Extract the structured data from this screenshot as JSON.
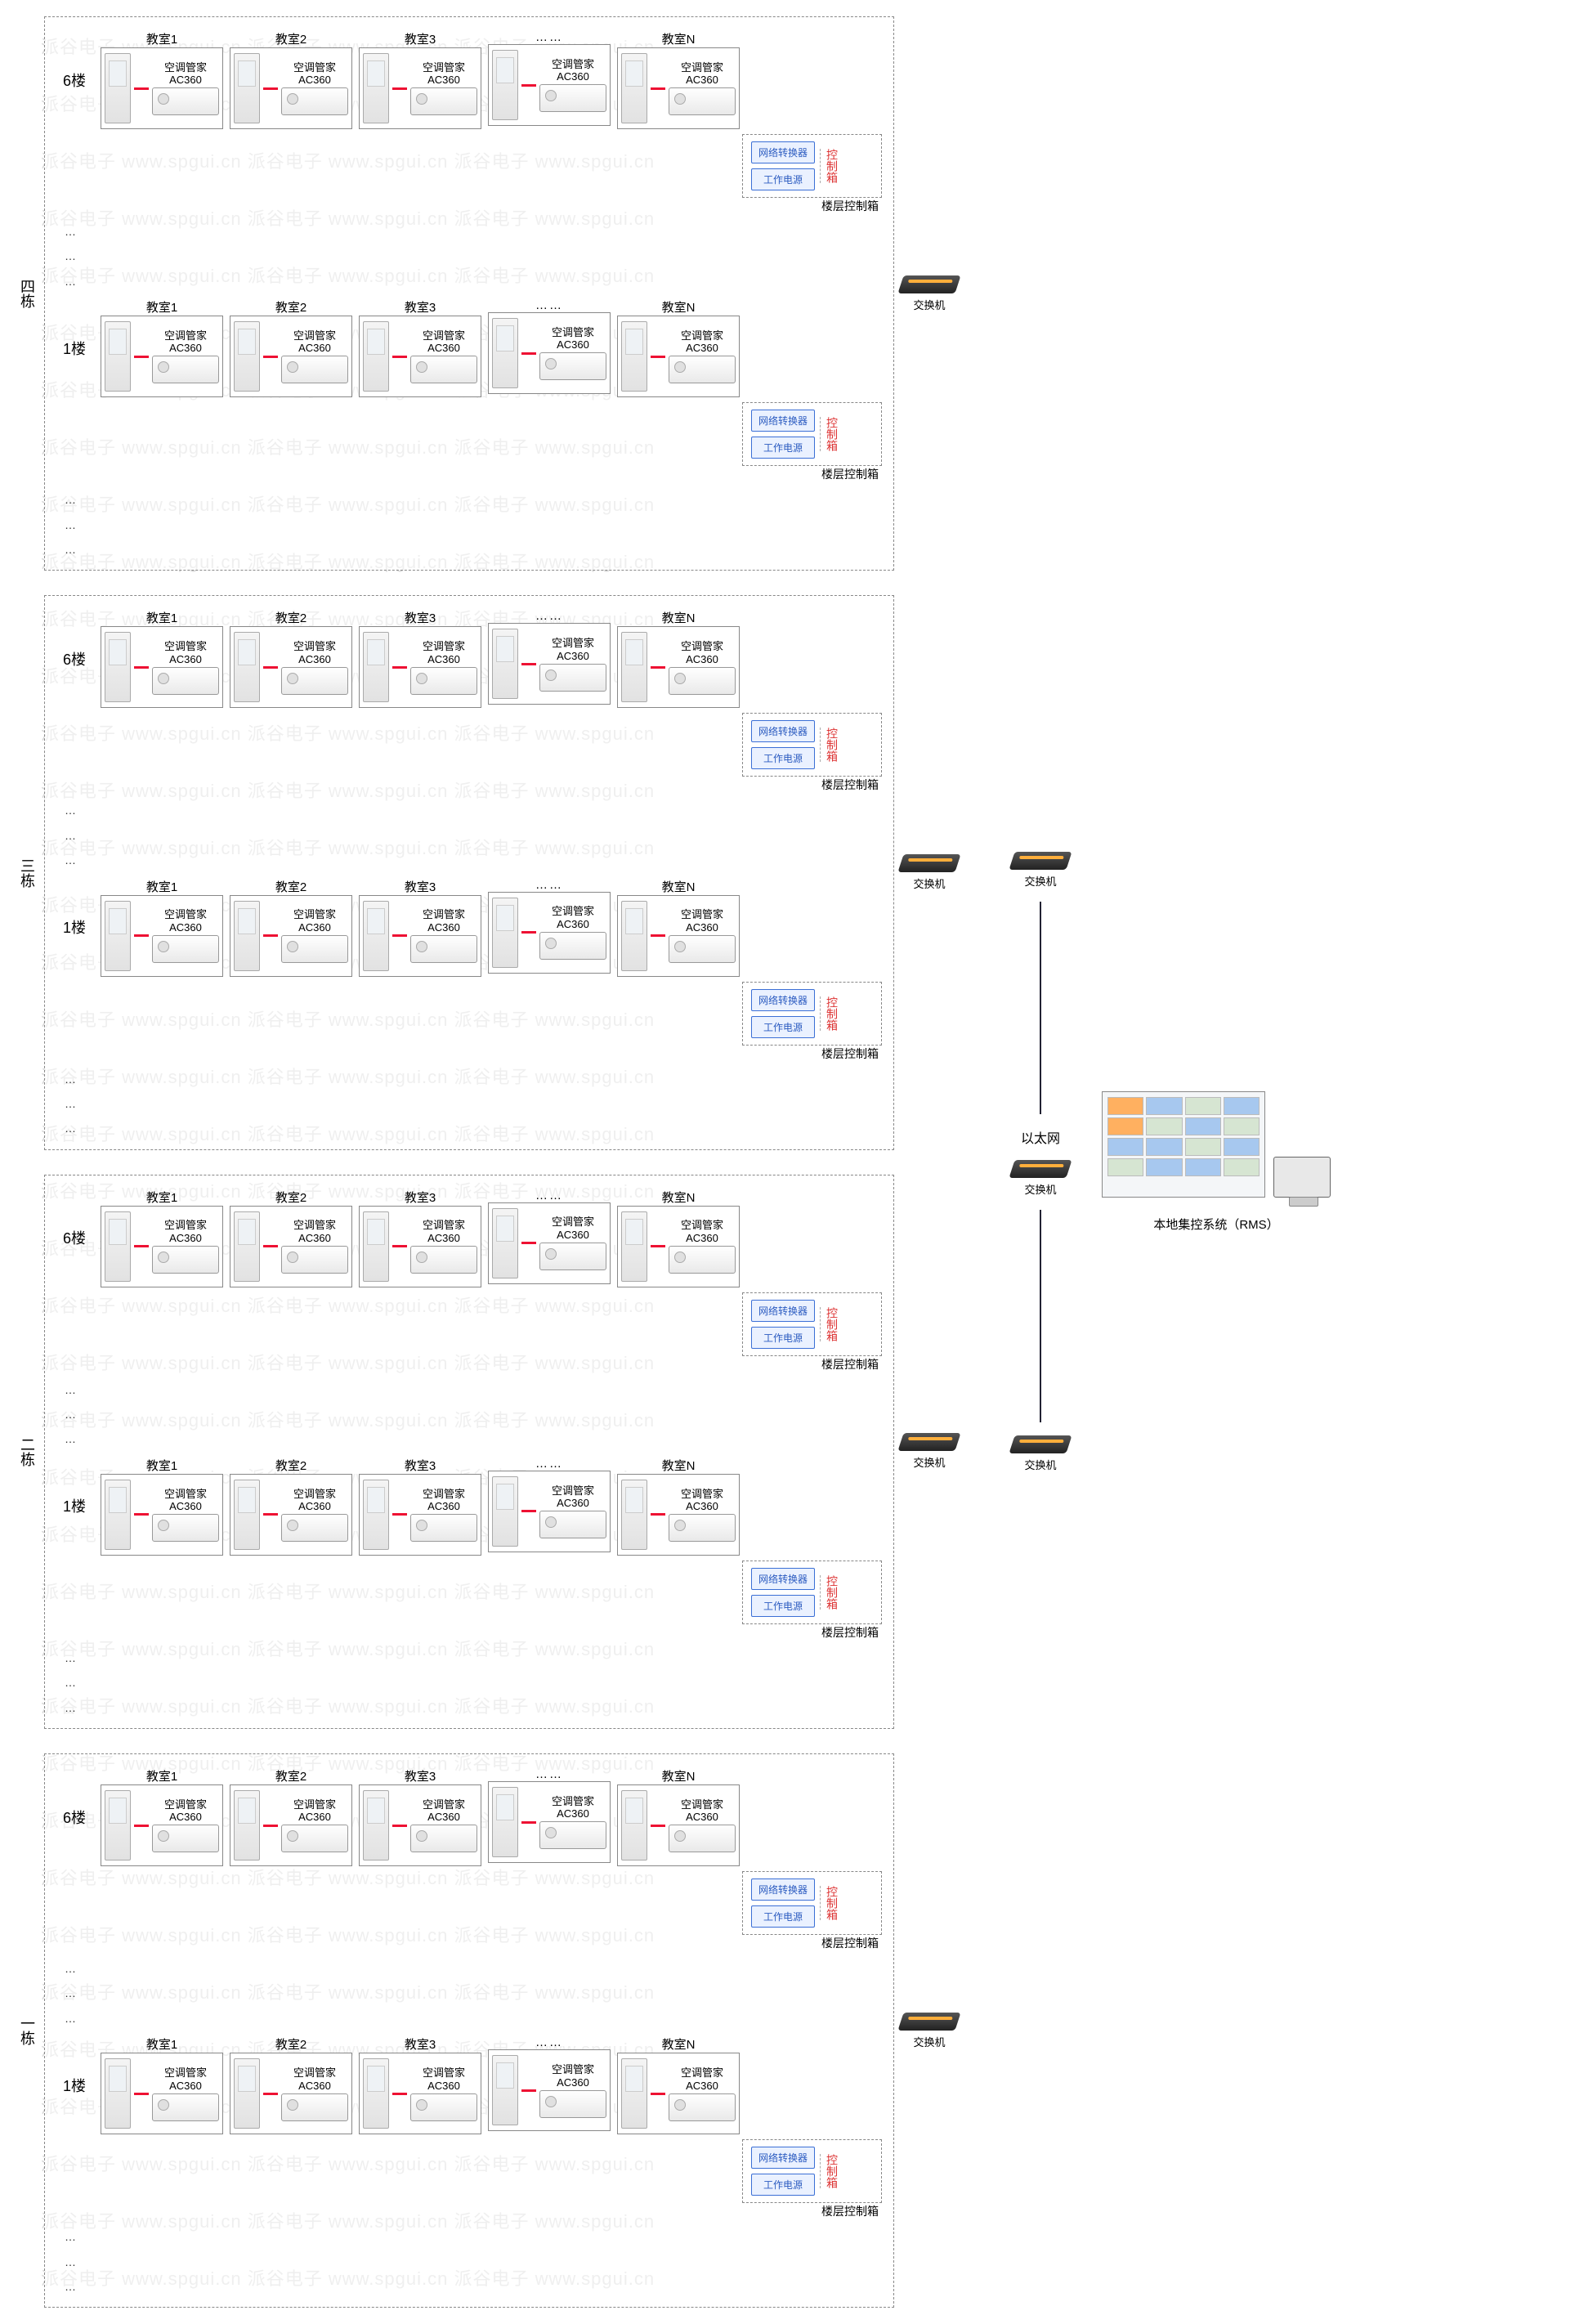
{
  "watermark": "派谷电子 www.spgui.cn 派谷电子 www.spgui.cn 派谷电子  www.spgui.cn",
  "room_labels": [
    "教室1",
    "教室2",
    "教室3",
    "……",
    "教室N"
  ],
  "controller_name": "空调管家",
  "controller_model": "AC360",
  "floor_top": "6楼",
  "floor_bottom": "1楼",
  "vertical_dots": "…\n…\n…",
  "controlbox": {
    "btn1": "网络转换器",
    "btn2": "工作电源",
    "side": "控制箱",
    "caption": "楼层控制箱"
  },
  "switch_label": "交换机",
  "ethernet_label": "以太网",
  "rms_label": "本地集控系统（RMS）",
  "buildings": [
    {
      "label": "四栋"
    },
    {
      "label": "三栋"
    },
    {
      "label": "二栋"
    },
    {
      "label": "一栋"
    }
  ]
}
